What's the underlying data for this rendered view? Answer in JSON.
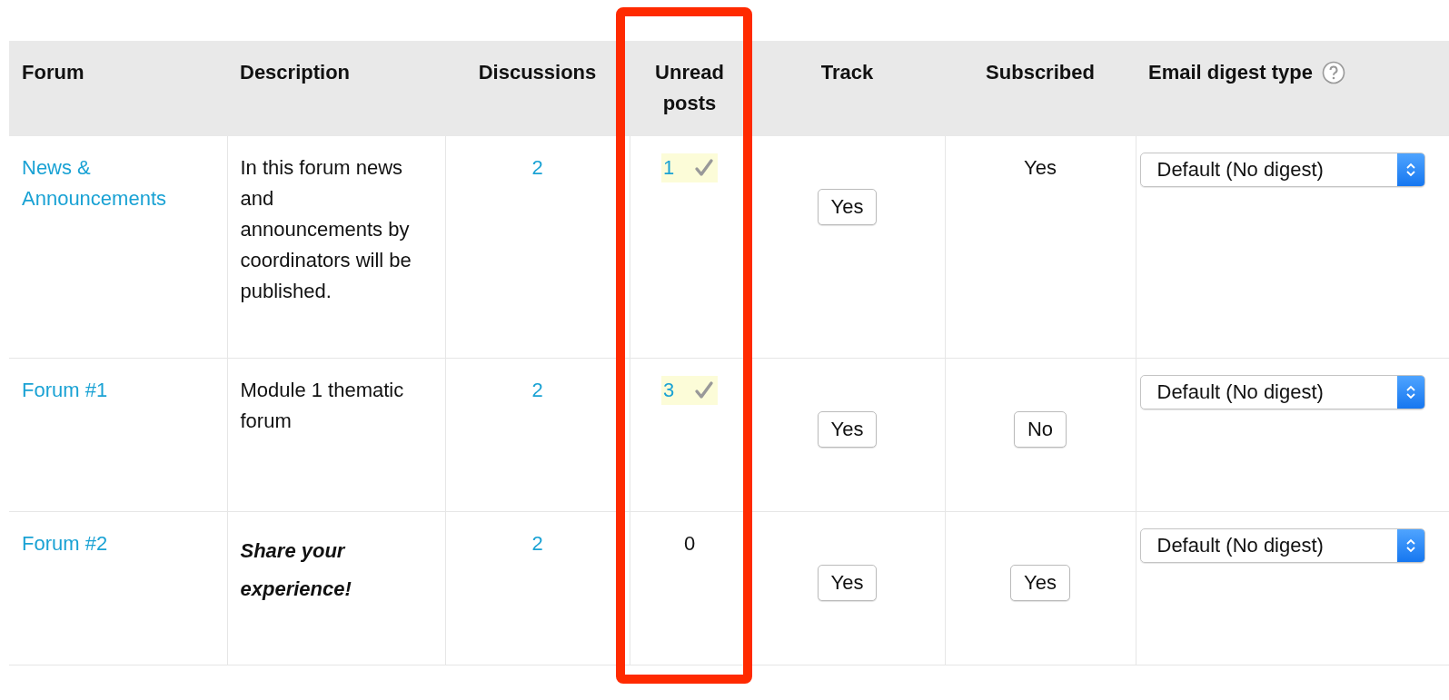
{
  "table": {
    "columns": [
      {
        "label": "Forum",
        "help": false
      },
      {
        "label": "Description",
        "help": false
      },
      {
        "label": "Discussions",
        "help": false
      },
      {
        "label": "Unread posts",
        "help": false
      },
      {
        "label": "Track",
        "help": false
      },
      {
        "label": "Subscribed",
        "help": false
      },
      {
        "label": "Email digest type",
        "help": true
      }
    ],
    "rows": [
      {
        "forum": "News & Announcements",
        "description": "In this forum news and announcements by coordinators will be published.",
        "description_emphasis": false,
        "discussions": "2",
        "unread": {
          "count": "1",
          "highlighted": true
        },
        "track": "Yes",
        "subscribed": {
          "kind": "text",
          "text": "Yes"
        },
        "digest": "Default (No digest)"
      },
      {
        "forum": "Forum #1",
        "description": "Module 1 thematic forum",
        "description_emphasis": false,
        "discussions": "2",
        "unread": {
          "count": "3",
          "highlighted": true
        },
        "track": "Yes",
        "subscribed": {
          "kind": "button",
          "text": "No"
        },
        "digest": "Default (No digest)"
      },
      {
        "forum": "Forum #2",
        "description": "Share your experience!",
        "description_emphasis": true,
        "discussions": "2",
        "unread": {
          "count": "0",
          "highlighted": false
        },
        "track": "Yes",
        "subscribed": {
          "kind": "button",
          "text": "Yes"
        },
        "digest": "Default (No digest)"
      }
    ]
  }
}
